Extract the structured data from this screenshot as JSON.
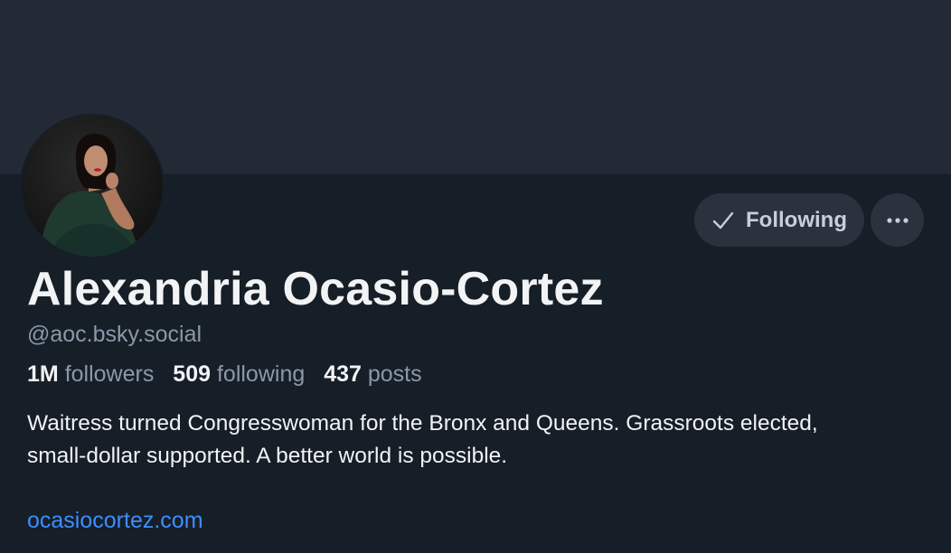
{
  "profile": {
    "display_name": "Alexandria Ocasio-Cortez",
    "handle": "@aoc.bsky.social",
    "stats": {
      "followers_count": "1M",
      "followers_label": "followers",
      "following_count": "509",
      "following_label": "following",
      "posts_count": "437",
      "posts_label": "posts"
    },
    "bio_line1": "Waitress turned Congresswoman for the Bronx and Queens. Grassroots elected,",
    "bio_line2": "small-dollar supported. A better world is possible.",
    "link": "ocasiocortez.com"
  },
  "actions": {
    "following_label": "Following",
    "following_icon": "checkmark-icon",
    "more_icon": "ellipsis-icon"
  },
  "colors": {
    "background": "#161e27",
    "banner": "#232a36",
    "button": "#2a323e",
    "text_primary": "#f1f3f5",
    "text_secondary": "#8c98a9",
    "link": "#3d8eff"
  }
}
